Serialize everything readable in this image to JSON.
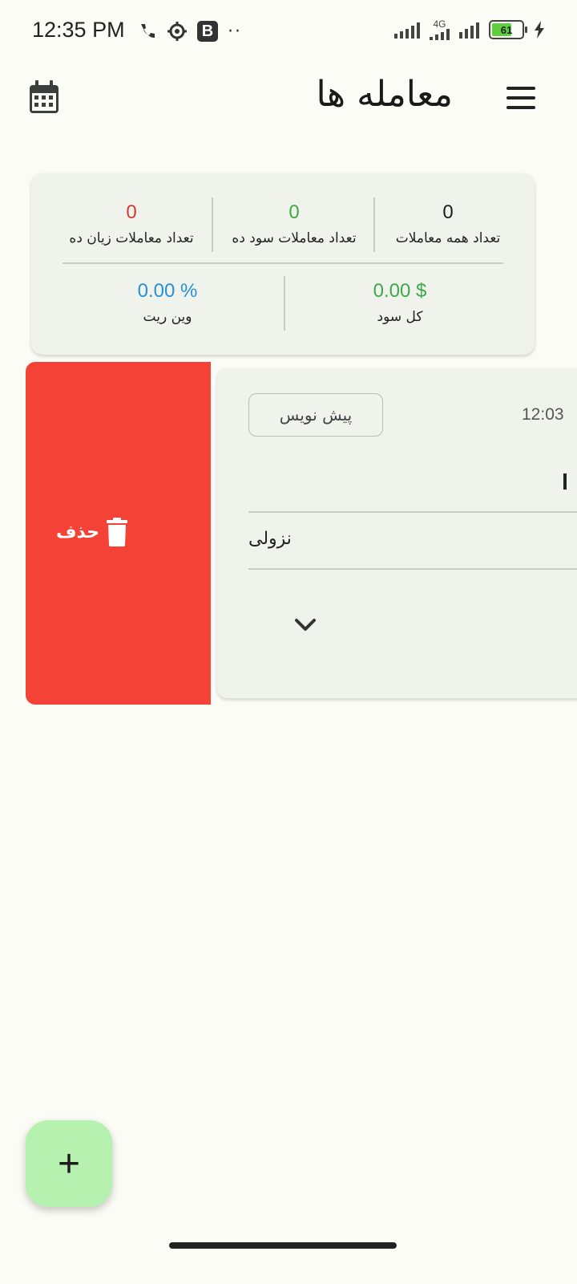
{
  "status_bar": {
    "time": "12:35 PM",
    "b_badge": "B",
    "dots": "··",
    "network": "4G",
    "battery": "61"
  },
  "header": {
    "title": "معامله ها",
    "calendar_icon": "calendar-icon",
    "menu_icon": "hamburger-menu-icon"
  },
  "summary": {
    "all_trades": {
      "value": "0",
      "label": "تعداد همه معاملات"
    },
    "profit_trades": {
      "value": "0",
      "label": "تعداد معاملات سود ده"
    },
    "loss_trades": {
      "value": "0",
      "label": "تعداد معاملات زیان ده"
    },
    "total_profit": {
      "value": "0.00 $",
      "label": "کل سود"
    },
    "win_rate": {
      "value": "0.00 %",
      "label": "وین ریت"
    },
    "colors": {
      "profit": "#3fa84a",
      "loss": "#d23b2e",
      "win_rate": "#2790d8"
    }
  },
  "trade_item": {
    "swipe_action": {
      "label": "حذف",
      "icon": "trash-icon",
      "color": "#f44336"
    },
    "status_chip": "پیش نویس",
    "time": "12:03",
    "direction": "نزولی",
    "expand_icon": "chevron-down-icon"
  },
  "fab": {
    "label": "+",
    "icon": "plus-icon",
    "color": "#b6f1b0"
  }
}
